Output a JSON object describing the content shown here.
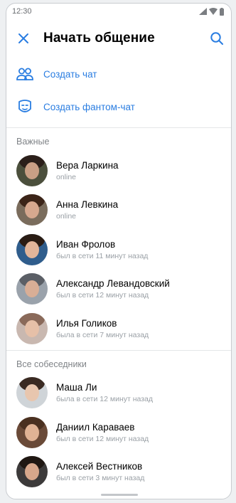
{
  "statusbar": {
    "time": "12:30"
  },
  "header": {
    "title": "Начать общение"
  },
  "actions": [
    {
      "label": "Создать чат",
      "icon": "group-chat-icon"
    },
    {
      "label": "Создать фантом-чат",
      "icon": "phantom-mask-icon"
    }
  ],
  "sections": {
    "important": "Важные",
    "all": "Все собеседники"
  },
  "important_contacts": [
    {
      "name": "Вера Ларкина",
      "status": "online",
      "skin": "#c99f85",
      "hair": "#2b1f1a",
      "bg": "#4b4f3c"
    },
    {
      "name": "Анна Левкина",
      "status": "online",
      "skin": "#d6a88f",
      "hair": "#3b2418",
      "bg": "#7a6c5c"
    },
    {
      "name": "Иван Фролов",
      "status": "был в сети 11 минут назад",
      "skin": "#e2b59a",
      "hair": "#2a1c14",
      "bg": "#2f5d8c"
    },
    {
      "name": "Александр Левандовский",
      "status": "был в сети 12 минут назад",
      "skin": "#d9ae96",
      "hair": "#5b5f66",
      "bg": "#9aa2ab"
    },
    {
      "name": "Илья Голиков",
      "status": "была в сети 7 минут назад",
      "skin": "#e6c0a8",
      "hair": "#8a6a5a",
      "bg": "#c9b8b0"
    }
  ],
  "all_contacts": [
    {
      "name": "Маша Ли",
      "status": "была в сети 12 минут назад",
      "skin": "#e8c6ae",
      "hair": "#3a2a22",
      "bg": "#cfd4d8"
    },
    {
      "name": "Даниил Караваев",
      "status": "был в сети 12 минут назад",
      "skin": "#e0b294",
      "hair": "#4a3020",
      "bg": "#6a4a38"
    },
    {
      "name": "Алексей Вестников",
      "status": "был в сети 3 минут назад",
      "skin": "#d7a78b",
      "hair": "#1f1712",
      "bg": "#3c3a3a"
    }
  ]
}
